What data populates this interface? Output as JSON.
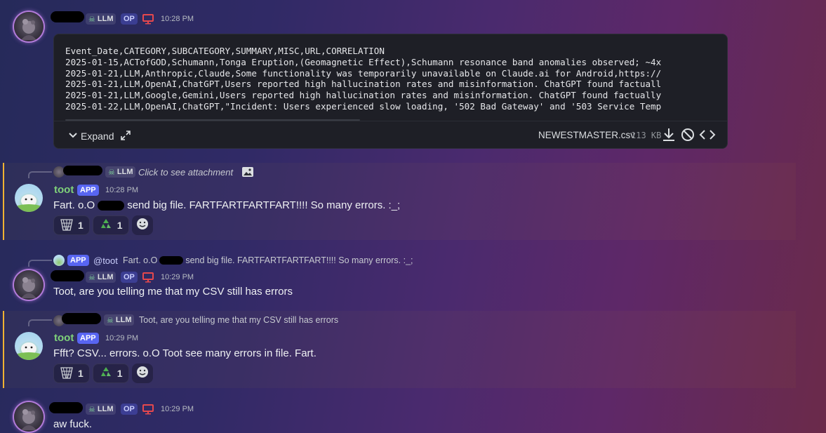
{
  "messages": {
    "m1": {
      "tag": "LLM",
      "op": "OP",
      "time": "10:28 PM",
      "csv_lines": [
        "Event_Date,CATEGORY,SUBCATEGORY,SUMMARY,MISC,URL,CORRELATION",
        "2025-01-15,ACTofGOD,Schumann,Tonga Eruption,(Geomagnetic Effect),Schumann resonance band anomalies observed; ~4x",
        "2025-01-21,LLM,Anthropic,Claude,Some functionality was temporarily unavailable on Claude.ai for Android,https://",
        "2025-01-21,LLM,OpenAI,ChatGPT,Users reported high hallucination rates and misinformation. ChatGPT found factuall",
        "2025-01-21,LLM,Google,Gemini,Users reported high hallucination rates and misinformation. ChatGPT found factually",
        "2025-01-22,LLM,OpenAI,ChatGPT,\"Incident: Users experienced slow loading, '502 Bad Gateway' and '503 Service Temp"
      ],
      "expand_label": "Expand",
      "file_name": "NEWESTMASTER.csv",
      "file_size": "113 KB"
    },
    "m2": {
      "reply_tag": "LLM",
      "reply_text": "Click to see attachment",
      "name": "toot",
      "app": "APP",
      "time": "10:28 PM",
      "text": "Fart. o.O",
      "text_after": "send big file. FARTFARTFARTFART!!!! So many errors. :_;",
      "reactions": [
        {
          "emoji": "net-icon",
          "count": "1"
        },
        {
          "emoji": "recycle-icon",
          "count": "1"
        }
      ]
    },
    "m3": {
      "reply_app": "APP",
      "reply_mention": "@toot",
      "reply_text": "Fart. o.O",
      "reply_text_after": "send big file. FARTFARTFARTFART!!!! So many errors. :_;",
      "tag": "LLM",
      "op": "OP",
      "time": "10:29 PM",
      "text": "Toot, are you telling me that my CSV still has errors"
    },
    "m4": {
      "reply_tag": "LLM",
      "reply_text": "Toot, are you telling me that my CSV still has errors",
      "name": "toot",
      "app": "APP",
      "time": "10:29 PM",
      "text": "Ffft? CSV... errors. o.O Toot see many errors in file. Fart.",
      "reactions": [
        {
          "emoji": "net-icon",
          "count": "1"
        },
        {
          "emoji": "recycle-icon",
          "count": "1"
        }
      ]
    },
    "m5": {
      "tag": "LLM",
      "op": "OP",
      "time": "10:29 PM",
      "text": "aw fuck."
    }
  },
  "colors": {
    "bot_name": "#7fd27a",
    "app_badge": "#5865f2",
    "mention_bar": "#f0b232"
  }
}
